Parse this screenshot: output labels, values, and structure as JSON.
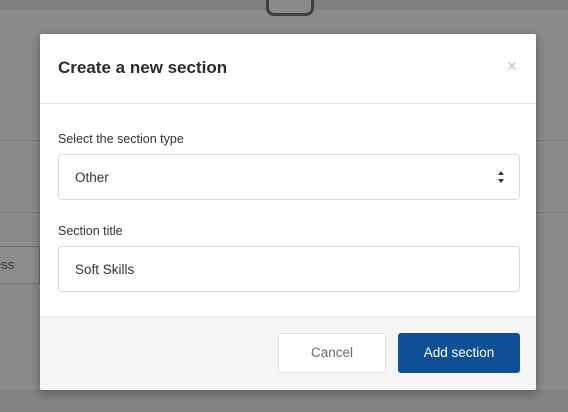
{
  "background": {
    "partial_text": "ess"
  },
  "modal": {
    "title": "Create a new section",
    "close_icon": "×",
    "section_type": {
      "label": "Select the section type",
      "selected_value": "Other"
    },
    "section_title": {
      "label": "Section title",
      "value": "Soft Skills"
    },
    "buttons": {
      "cancel_label": "Cancel",
      "add_label": "Add section"
    }
  },
  "colors": {
    "primary_button": "#0e4f95",
    "overlay": "#8a8a8a"
  }
}
